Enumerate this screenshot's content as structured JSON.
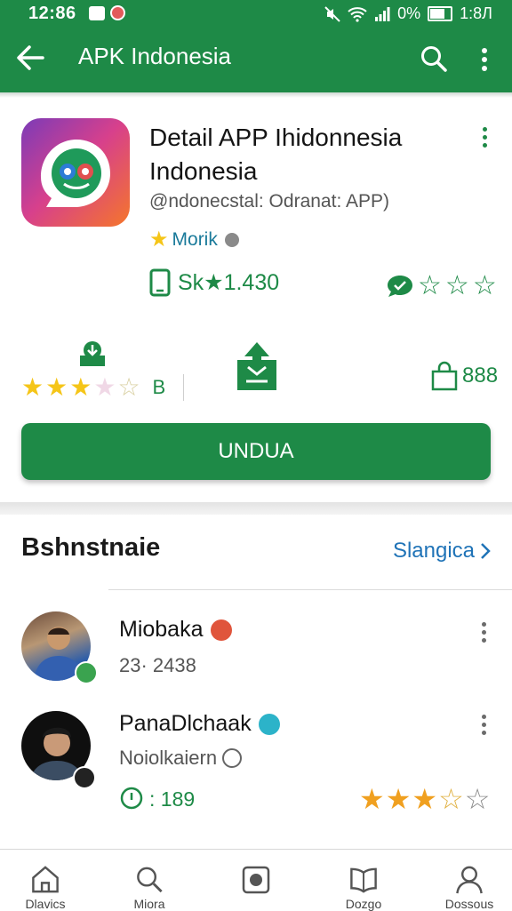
{
  "status": {
    "time": "12:86",
    "battery": "0%",
    "clock_right": "1:8Л"
  },
  "appbar": {
    "title": "APK Indonesia"
  },
  "app": {
    "name_line1": "Detail APP Ihidonnesia",
    "name_line2": "Indonesia",
    "subtitle": "@ndonecstal: Odranat: APP)",
    "tag": "Morik",
    "size_text": "Sk★1.430",
    "rating_label": "B",
    "downloads": "888",
    "install_label": "UNDUA"
  },
  "section": {
    "title": "Bshnstnaie",
    "link": "Slangica"
  },
  "reviews": [
    {
      "name": "Miobaka",
      "meta": "23· 2438"
    },
    {
      "name": "PanaDlchaak",
      "meta": "Noiolkaiern",
      "count": ": 189"
    }
  ],
  "colors": {
    "primary": "#1e8a47",
    "star": "#f5c518",
    "star_orange": "#f0a020",
    "link": "#1f73b7"
  },
  "nav": [
    {
      "label": "Dlavics",
      "icon": "home-icon"
    },
    {
      "label": "Miora",
      "icon": "search-icon"
    },
    {
      "label": "",
      "icon": "record-icon"
    },
    {
      "label": "Dozgo",
      "icon": "book-icon"
    },
    {
      "label": "Dossous",
      "icon": "person-icon"
    }
  ]
}
